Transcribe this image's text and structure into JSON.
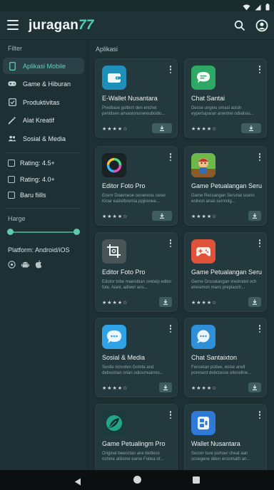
{
  "app": {
    "brand_name": "juragan",
    "brand_suffix": "77"
  },
  "sidebar": {
    "filter_heading": "Filter",
    "categories": [
      {
        "label": "Aplikasi Mobile",
        "icon": "phone-icon",
        "active": true
      },
      {
        "label": "Game & Hiburan",
        "icon": "gamepad-icon",
        "active": false
      },
      {
        "label": "Produktivitas",
        "icon": "checkbox-icon",
        "active": false
      },
      {
        "label": "Alat Kreatif",
        "icon": "wand-icon",
        "active": false
      },
      {
        "label": "Sosial & Media",
        "icon": "people-icon",
        "active": false
      }
    ],
    "checkboxes": [
      {
        "label": "Rating: 4.5+",
        "checked": false
      },
      {
        "label": "Rating: 4.0+",
        "checked": false
      },
      {
        "label": "Baru fiills",
        "checked": false
      }
    ],
    "price_heading": "Harge",
    "price_range": [
      0,
      1
    ],
    "platform_label": "Platform: Android/iOS",
    "platform_icons": [
      "disc-icon",
      "android-icon",
      "apple-icon"
    ]
  },
  "main": {
    "section_title": "Aplikasi",
    "cards": [
      {
        "title": "E-Wallet Nusantara",
        "desc": "Prediiase golbnrt den enchet pentlisen arivaoionunereuboido...",
        "rating": "★★★★☆",
        "icon": "wallet-icon",
        "icon_color": "#1d8fb8"
      },
      {
        "title": "Chat Santai",
        "desc": "Desse ungivu omasi astoh eypertaparan anentrel odialnas...",
        "rating": "★★★★☆",
        "icon": "chat-bubble-icon",
        "icon_color": "#2ea865"
      },
      {
        "title": "Editor Foto Pro",
        "desc": "Ecenr Drakmeoe oonerenis cexer Kioar ealisitbremia ppjirenee...",
        "rating": "★★★★☆",
        "icon": "color-ring-icon",
        "icon_color": "#1a2224"
      },
      {
        "title": "Game Petualangan Seru",
        "desc": "Game Recsangan Serunat scerin enlivon anas sermnlg...",
        "rating": "★★★★☆",
        "icon": "adventure-character-icon",
        "icon_color": "#3a8a3a"
      },
      {
        "title": "Editor Foto Pro",
        "desc": "Edutor tobe maeisbian sveteip editor fote, Aiani, adiwor ans...",
        "rating": "★★★★☆",
        "icon": "crop-icon",
        "icon_color": "#4a5558"
      },
      {
        "title": "Game Petualangan Seru",
        "desc": "Gerne Grooatangan vredrodel och elresimon mans prepiaoch...",
        "rating": "★★★★☆",
        "icon": "gamepad-icon",
        "icon_color": "#e0533a"
      },
      {
        "title": "Sosial & Media",
        "desc": "Sostle mirvolen Gomte and debsoirian orian odiosmuarres...",
        "rating": "★★★★☆",
        "icon": "chat-face-icon",
        "icon_color": "#2fa3e6"
      },
      {
        "title": "Chat Santaixton",
        "desc": "Fenoetan potiee, enise anell poresent debctesse oiloceline...",
        "rating": "★★★★☆",
        "icon": "message-icon",
        "icon_color": "#2f8fd8"
      },
      {
        "title": "Game Petualingm Pro",
        "desc": "Original beenctan ane biotless ochme aliiisme eame Fotiea of...",
        "rating": "",
        "icon": "leaf-icon",
        "icon_color": "#1c3b3c"
      },
      {
        "title": "Wallet Nusantara",
        "desc": "Secrer tsoe portoer cheat aan sosegene dden erciomath an...",
        "rating": "",
        "icon": "wallet-app-icon",
        "icon_color": "#2f79d8"
      }
    ]
  },
  "colors": {
    "accent": "#57d6b9",
    "background": "#1d3034",
    "card": "#24393d"
  }
}
